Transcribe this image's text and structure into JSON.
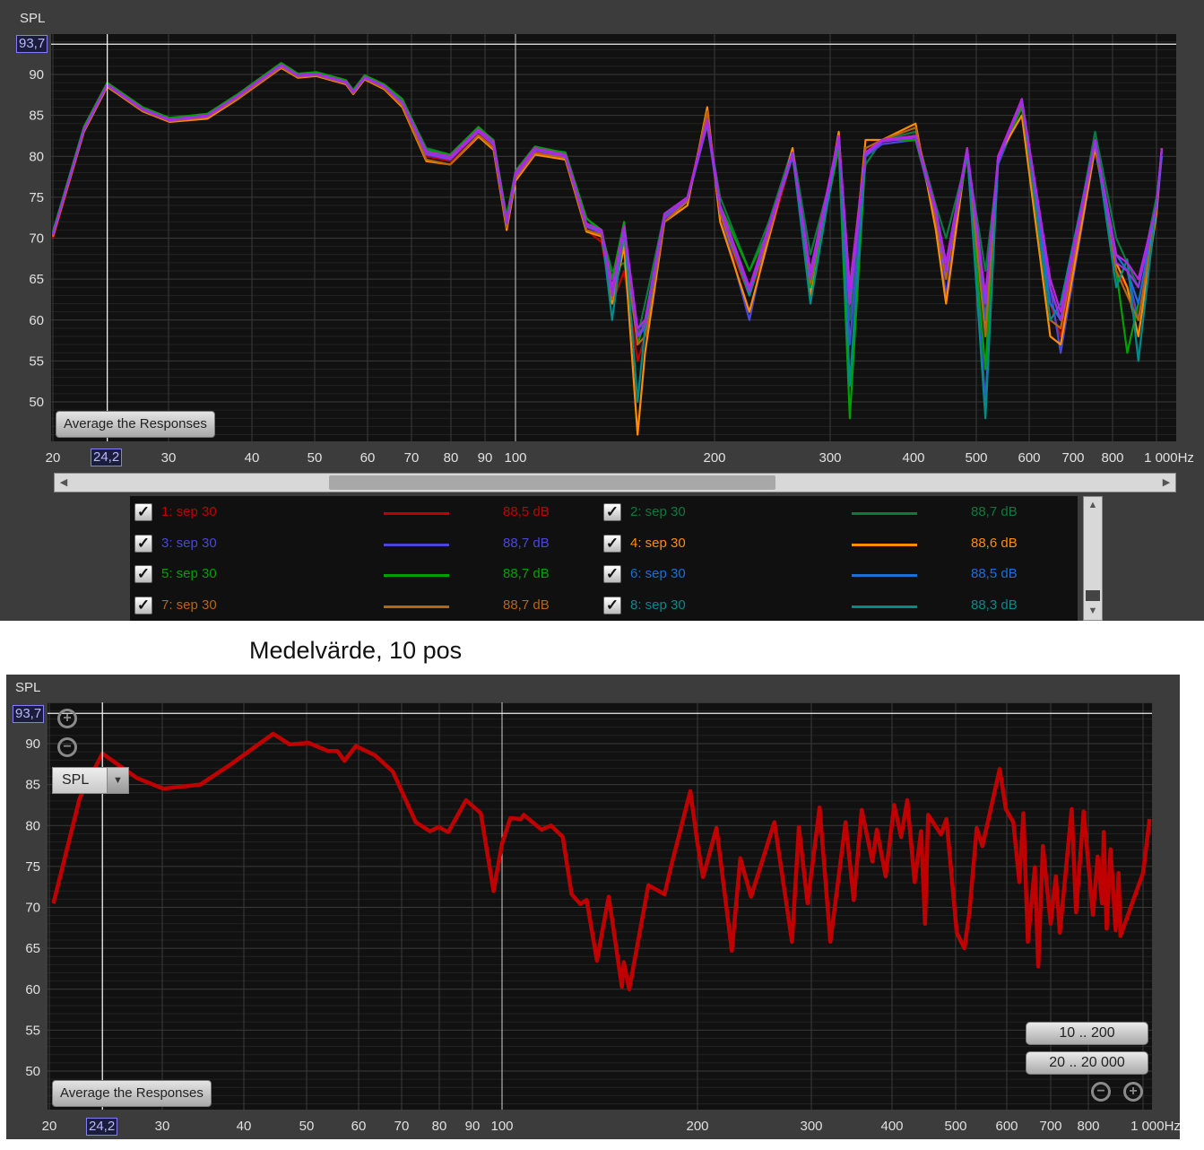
{
  "top_panel": {
    "y_axis_label": "SPL",
    "cursor": {
      "y_value": "93,7",
      "x_value": "24,2"
    },
    "average_button": "Average the Responses",
    "legend": [
      {
        "label": "1: sep 30",
        "value": "88,5 dB",
        "color": "#c00000",
        "checked": true
      },
      {
        "label": "2: sep 30",
        "value": "88,7 dB",
        "color": "#0b7a3e",
        "checked": true
      },
      {
        "label": "3: sep 30",
        "value": "88,7 dB",
        "color": "#4848d8",
        "checked": true
      },
      {
        "label": "4: sep 30",
        "value": "88,6 dB",
        "color": "#ff8c00",
        "checked": true
      },
      {
        "label": "5: sep 30",
        "value": "88,7 dB",
        "color": "#00a000",
        "checked": true
      },
      {
        "label": "6: sep 30",
        "value": "88,5 dB",
        "color": "#1a6fd8",
        "checked": true
      },
      {
        "label": "7: sep 30",
        "value": "88,7 dB",
        "color": "#b8650f",
        "checked": true
      },
      {
        "label": "8: sep 30",
        "value": "88,3 dB",
        "color": "#008b8b",
        "checked": true
      }
    ]
  },
  "caption": "Medelvärde, 10 pos",
  "bottom_panel": {
    "y_axis_label": "SPL",
    "cursor": {
      "y_value": "93,7",
      "x_value": "24,2"
    },
    "dropdown": "SPL",
    "range_buttons": [
      "10 .. 200",
      "20 .. 20 000"
    ],
    "average_button": "Average the Responses"
  },
  "chart_data": [
    {
      "type": "line",
      "x_scale": "log",
      "xlim": [
        19.9,
        1050
      ],
      "ylim": [
        45.2,
        94.8
      ],
      "grid": true,
      "y_tick_labels": [
        "90",
        "85",
        "80",
        "75",
        "70",
        "65",
        "60",
        "55",
        "50"
      ],
      "x_tick_labels": [
        "20",
        "30",
        "40",
        "50",
        "60",
        "70",
        "80",
        "90",
        "100",
        "200",
        "300",
        "400",
        "500",
        "600",
        "700",
        "800",
        "1 000Hz"
      ],
      "cursor": {
        "x": 24.2,
        "y": 93.7
      },
      "x": [
        20,
        22.3,
        24.2,
        27.4,
        30.1,
        34.3,
        38.1,
        44.4,
        47.1,
        50.3,
        55.7,
        57.1,
        59.4,
        63.6,
        67.8,
        73.6,
        79.8,
        88,
        92.7,
        97,
        100,
        107,
        119,
        128,
        135,
        140,
        146,
        153,
        157,
        168,
        182,
        195,
        204,
        226,
        242,
        263,
        280,
        309,
        321,
        339,
        359,
        403,
        433,
        449,
        484,
        516,
        539,
        585,
        646,
        670,
        754,
        815,
        862,
        912,
        1000,
        1027
      ],
      "series": [
        {
          "name": "1: sep 30",
          "color": "#c00000",
          "values": [
            70,
            83,
            88.6,
            85.6,
            84.4,
            84.8,
            87.2,
            91,
            89.8,
            90,
            89,
            87.8,
            89.6,
            88.4,
            86.4,
            80,
            79.4,
            83,
            81.2,
            71.5,
            77.5,
            80.6,
            80.2,
            71,
            69.5,
            62,
            66,
            55,
            58,
            72,
            75,
            85,
            72,
            63,
            70,
            80,
            64,
            82,
            62,
            80,
            82,
            83,
            72,
            66,
            81,
            60,
            80,
            87,
            62,
            58,
            82,
            66,
            64,
            60,
            74,
            81
          ]
        },
        {
          "name": "2: sep 30",
          "color": "#0b7a3e",
          "values": [
            70.3,
            83.5,
            88.9,
            85.9,
            84.6,
            85.1,
            87.5,
            91.3,
            90,
            90.2,
            89.2,
            88,
            89.8,
            88.7,
            86.9,
            81,
            80.2,
            83.5,
            82,
            72.5,
            78,
            81,
            80.5,
            72.5,
            70.5,
            66,
            67,
            58,
            62,
            73,
            75,
            84,
            75,
            66,
            72,
            81,
            68,
            81,
            60,
            79,
            82,
            83,
            74,
            70,
            80,
            66,
            79,
            86,
            64,
            60,
            83,
            70,
            67,
            64,
            75,
            80
          ]
        },
        {
          "name": "3: sep 30",
          "color": "#4848d8",
          "values": [
            70.6,
            83.4,
            88.7,
            85.7,
            84.5,
            84.9,
            87.3,
            91.1,
            89.8,
            90,
            89,
            87.7,
            89.5,
            88.5,
            86.5,
            80.2,
            79.6,
            83.2,
            81.4,
            71.8,
            77.6,
            80.7,
            80.1,
            71.4,
            70.6,
            62.5,
            70.8,
            59,
            59.5,
            72.4,
            74.6,
            83.8,
            73.2,
            60,
            71,
            80,
            65,
            82,
            57,
            80,
            81.5,
            82,
            72.5,
            63,
            80.5,
            50,
            79,
            87,
            64,
            56,
            81,
            68,
            66,
            60,
            73,
            80
          ]
        },
        {
          "name": "4: sep 30",
          "color": "#ff8c00",
          "values": [
            70.2,
            83,
            88.5,
            85.5,
            84.2,
            84.6,
            87,
            90.8,
            89.6,
            89.8,
            88.8,
            87.6,
            89.4,
            88.2,
            86,
            79.4,
            79,
            82.4,
            80.8,
            71,
            77,
            80.2,
            79.6,
            70.8,
            70.2,
            62,
            69,
            46,
            56,
            72,
            74,
            86,
            72,
            61,
            70,
            81,
            63,
            83,
            62,
            82,
            82,
            84,
            71,
            62,
            81,
            59,
            80,
            85,
            58,
            57,
            81,
            67,
            64,
            58,
            73,
            81
          ]
        },
        {
          "name": "5: sep 30",
          "color": "#00a000",
          "values": [
            70.8,
            83.6,
            89,
            86,
            84.7,
            85.2,
            87.6,
            91.4,
            90.1,
            90.3,
            89.3,
            88.1,
            89.9,
            88.8,
            87,
            80.8,
            80.2,
            83.6,
            81.9,
            72.6,
            78.2,
            81.2,
            80.4,
            72.4,
            71,
            65,
            72,
            57,
            60,
            73,
            75,
            84,
            74,
            66,
            71,
            80,
            64,
            81,
            48,
            80,
            82,
            82,
            73,
            66,
            80,
            54,
            80,
            86,
            64,
            60,
            82,
            66,
            56,
            62,
            74,
            81
          ]
        },
        {
          "name": "6: sep 30",
          "color": "#1a6fd8",
          "values": [
            70.4,
            83.2,
            88.7,
            85.7,
            84.4,
            84.9,
            87.3,
            91.1,
            89.8,
            90,
            89,
            87.8,
            89.6,
            88.5,
            86.5,
            80.3,
            79.7,
            83.1,
            81.5,
            71.8,
            77.7,
            80.8,
            80,
            71.5,
            70.7,
            63,
            70,
            58,
            59,
            72.5,
            75,
            84,
            73.5,
            64,
            71,
            80,
            65,
            82,
            63,
            80,
            82,
            82.5,
            73,
            67,
            80.5,
            60,
            79.5,
            87,
            62,
            60,
            82,
            68,
            66,
            62,
            74,
            80
          ]
        },
        {
          "name": "7: sep 30",
          "color": "#b8650f",
          "values": [
            70.3,
            83.1,
            88.6,
            85.6,
            84.3,
            84.8,
            87.1,
            90.9,
            89.7,
            89.9,
            88.9,
            87.7,
            89.5,
            88.3,
            86.2,
            79.6,
            79,
            82.6,
            81,
            71.3,
            77.3,
            80.4,
            79.8,
            71,
            70.4,
            62.5,
            70,
            57,
            58,
            72,
            74.5,
            85.5,
            73,
            63,
            70.5,
            80.5,
            64.5,
            82.5,
            64,
            81,
            82,
            83.5,
            72.5,
            65,
            81,
            58,
            80,
            86.5,
            60,
            59,
            81.5,
            66,
            63,
            60,
            73.5,
            81
          ]
        },
        {
          "name": "8: sep 30",
          "color": "#008b8b",
          "values": [
            70.6,
            83.3,
            88.8,
            85.8,
            84.5,
            85,
            87.4,
            91.2,
            89.9,
            90.1,
            89.1,
            87.9,
            89.7,
            88.6,
            86.6,
            80.4,
            79.8,
            83.1,
            81.5,
            72,
            77.8,
            80.8,
            80,
            71.6,
            70.9,
            60,
            71,
            50,
            59,
            72.7,
            74.9,
            84,
            73.7,
            63,
            71.3,
            80.4,
            62,
            82.2,
            52,
            80.4,
            81.9,
            82.5,
            73.1,
            66,
            80.8,
            48,
            79.7,
            86.9,
            60,
            62,
            82,
            64,
            67.4,
            55,
            74.2,
            80.8
          ]
        },
        {
          "color": "#c020e0",
          "values": [
            70.5,
            83.3,
            88.8,
            85.8,
            84.5,
            85,
            87.4,
            91.2,
            89.9,
            90.1,
            89.1,
            87.9,
            89.7,
            88.6,
            86.6,
            80.6,
            80,
            83.3,
            81.8,
            72,
            78,
            81,
            80.2,
            71.8,
            71,
            64,
            71.5,
            59,
            60,
            73,
            75,
            84.5,
            74,
            64,
            71.5,
            80.5,
            66,
            82.5,
            64,
            80.5,
            82,
            82.5,
            73.5,
            67,
            81,
            63,
            80,
            87,
            65,
            61,
            82,
            68,
            67,
            65,
            74,
            81
          ]
        },
        {
          "color": "#9a30e8",
          "values": [
            70.4,
            83.2,
            88.7,
            85.7,
            84.4,
            84.9,
            87.3,
            91.1,
            89.8,
            90,
            89,
            87.8,
            89.6,
            88.5,
            86.5,
            80.3,
            79.7,
            83,
            81.4,
            71.8,
            77.6,
            80.7,
            80,
            71.4,
            70.7,
            63,
            71,
            58,
            59.5,
            72.5,
            74.8,
            84,
            73.5,
            63.5,
            71,
            80.3,
            65,
            82,
            62,
            80.2,
            81.8,
            82.3,
            73,
            66,
            80.6,
            62,
            79.5,
            86.7,
            64,
            60,
            81.8,
            67,
            66,
            64,
            74,
            80.6
          ]
        }
      ]
    },
    {
      "type": "line",
      "x_scale": "log",
      "xlim": [
        19.8,
        1035
      ],
      "ylim": [
        45.2,
        94.8
      ],
      "grid": true,
      "y_tick_labels": [
        "90",
        "85",
        "80",
        "75",
        "70",
        "65",
        "60",
        "55",
        "50"
      ],
      "x_tick_labels": [
        "20",
        "30",
        "40",
        "50",
        "60",
        "70",
        "80",
        "90",
        "100",
        "200",
        "300",
        "400",
        "500",
        "600",
        "700",
        "800",
        "1 000Hz"
      ],
      "cursor": {
        "x": 24.2,
        "y": 93.7
      },
      "x": [
        20.3,
        22.3,
        24.2,
        27.4,
        30.1,
        34.3,
        38.1,
        44.4,
        47.1,
        50.3,
        53.9,
        55.7,
        57.1,
        59.4,
        63.6,
        67.8,
        73.6,
        77.4,
        79.8,
        82.6,
        88,
        92.7,
        97,
        100,
        103,
        107,
        108,
        115,
        119,
        124,
        128,
        132,
        135,
        140,
        146,
        153,
        154,
        157,
        168,
        178,
        182,
        195,
        200,
        204,
        214,
        226,
        233,
        242,
        263,
        280,
        287,
        296,
        309,
        321,
        339,
        349,
        359,
        373,
        379,
        391,
        403,
        413,
        422,
        433,
        443,
        449,
        454,
        475,
        484,
        502,
        516,
        525,
        539,
        550,
        560,
        585,
        598,
        614,
        627,
        636,
        646,
        662,
        670,
        681,
        700,
        713,
        723,
        738,
        754,
        766,
        787,
        815,
        831,
        846,
        852,
        862,
        876,
        894,
        905,
        912,
        1000,
        1027
      ],
      "series": [
        {
          "color": "#c00000",
          "values": [
            70.5,
            83.3,
            88.8,
            85.8,
            84.5,
            85,
            87.4,
            91.2,
            89.9,
            90.1,
            89.1,
            89.1,
            87.9,
            89.7,
            88.6,
            86.6,
            80.4,
            79.3,
            79.8,
            79.2,
            83.1,
            81.5,
            72,
            77.8,
            80.9,
            80.8,
            81.3,
            79.5,
            80,
            78.6,
            71.6,
            70.4,
            70.9,
            63.5,
            71.3,
            60.3,
            63.3,
            60,
            72.7,
            71.6,
            74.9,
            84.2,
            77.8,
            73.7,
            79.7,
            64.7,
            76,
            71.3,
            80.4,
            65.8,
            79.8,
            70.5,
            82.2,
            65.8,
            80.4,
            70.9,
            81.9,
            75.6,
            79.5,
            73.8,
            82.5,
            78.6,
            83.1,
            73.1,
            79.3,
            68,
            81.3,
            78.9,
            80.8,
            66.9,
            65,
            69.4,
            79.7,
            77.5,
            80.2,
            86.9,
            82,
            80.4,
            73.1,
            81.5,
            65.8,
            74.9,
            62.8,
            77.5,
            68,
            73.8,
            66.9,
            74.2,
            82,
            69.4,
            81.7,
            69.1,
            76.2,
            70.5,
            79.2,
            67.4,
            77.1,
            67.2,
            74.2,
            66.5,
            74.2,
            80.8
          ]
        }
      ]
    }
  ]
}
